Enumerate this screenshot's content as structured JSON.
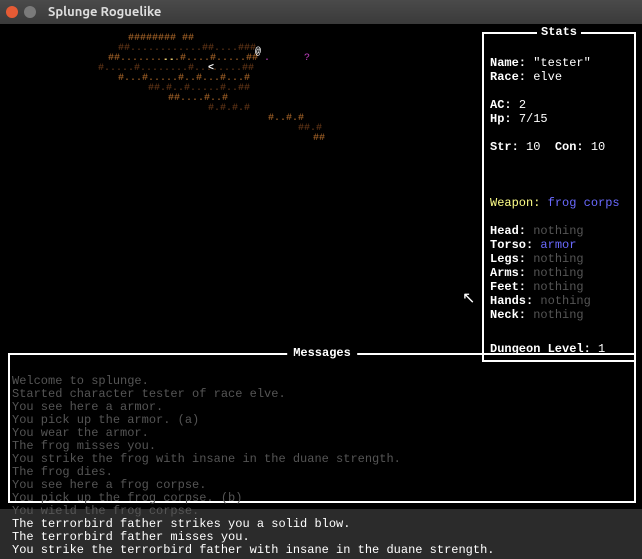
{
  "window": {
    "title": "Splunge Roguelike"
  },
  "stats": {
    "panel_title": "Stats",
    "name_label": "Name:",
    "name_value": "\"tester\"",
    "race_label": "Race:",
    "race_value": "elve",
    "ac_label": "AC:",
    "ac_value": "2",
    "hp_label": "Hp:",
    "hp_value": "7/15",
    "str_label": "Str:",
    "str_value": "10",
    "con_label": "Con:",
    "con_value": "10",
    "weapon_label": "Weapon:",
    "weapon_value": "frog corps",
    "slots": [
      {
        "label": "Head:",
        "value": "nothing",
        "cls": "nothing"
      },
      {
        "label": "Torso:",
        "value": "armor",
        "cls": "blue"
      },
      {
        "label": "Legs:",
        "value": "nothing",
        "cls": "nothing"
      },
      {
        "label": "Arms:",
        "value": "nothing",
        "cls": "nothing"
      },
      {
        "label": "Feet:",
        "value": "nothing",
        "cls": "nothing"
      },
      {
        "label": "Hands:",
        "value": "nothing",
        "cls": "nothing"
      },
      {
        "label": "Neck:",
        "value": "nothing",
        "cls": "nothing"
      }
    ],
    "dungeon_label": "Dungeon Level:",
    "dungeon_value": "1"
  },
  "messages": {
    "panel_title": "Messages",
    "lines": [
      {
        "text": "Welcome to splunge.",
        "old": true
      },
      {
        "text": "Started character tester of race elve.",
        "old": true
      },
      {
        "text": "You see here a armor.",
        "old": true
      },
      {
        "text": "You pick up the armor. (a)",
        "old": true
      },
      {
        "text": "You wear the armor.",
        "old": true
      },
      {
        "text": "The frog misses you.",
        "old": true
      },
      {
        "text": "You strike the frog with insane in the duane strength.",
        "old": true
      },
      {
        "text": "The frog dies.",
        "old": true
      },
      {
        "text": "You see here a frog corpse.",
        "old": true
      },
      {
        "text": "You pick up the frog corpse. (b)",
        "old": true
      },
      {
        "text": "You wield the frog corpse.",
        "old": true
      },
      {
        "text": "The terrorbird father strikes you a solid blow.",
        "old": false
      },
      {
        "text": "The terrorbird father misses you.",
        "old": false
      },
      {
        "text": "You strike the terrorbird father with insane in the duane strength.",
        "old": false
      }
    ]
  },
  "map": {
    "player_glyph": "@",
    "cursor_glyph": "<",
    "mark_glyph": "?",
    "colors": {
      "floor": "#b06a2a",
      "wall_dark": "#6a3a18",
      "bright": "#ffff99",
      "magenta": "#c040c0",
      "player": "#ffffff"
    }
  },
  "cursor_pointer": "↖"
}
